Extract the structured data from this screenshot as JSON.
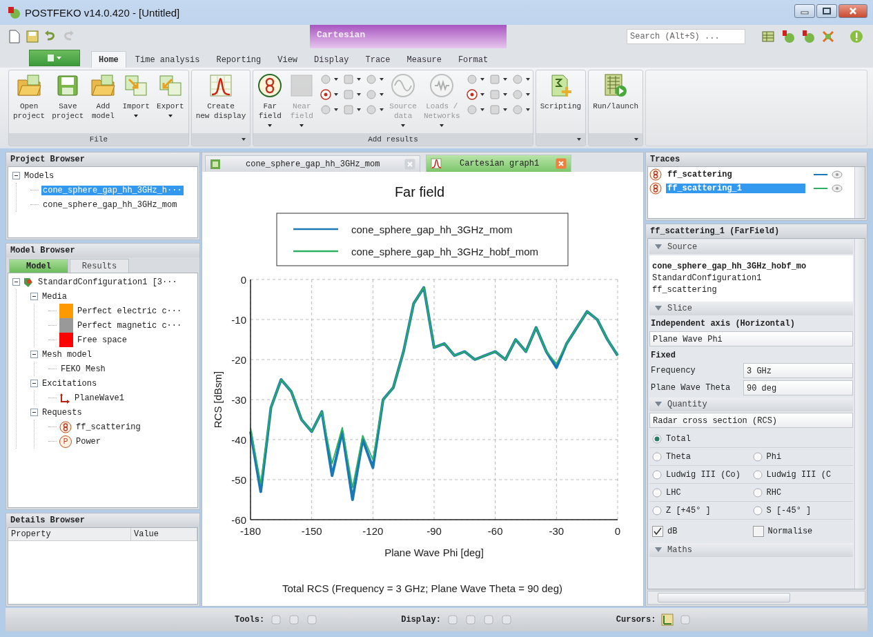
{
  "window": {
    "title": "POSTFEKO v14.0.420 - [Untitled]"
  },
  "contextual_tab_group": {
    "label": "Cartesian"
  },
  "search": {
    "placeholder": "Search (Alt+S) ..."
  },
  "ribbon_tabs": [
    {
      "label": "Home",
      "selected": true,
      "contextual": false
    },
    {
      "label": "Time analysis",
      "selected": false,
      "contextual": false
    },
    {
      "label": "Reporting",
      "selected": false,
      "contextual": false
    },
    {
      "label": "View",
      "selected": false,
      "contextual": false
    },
    {
      "label": "Display",
      "selected": false,
      "contextual": true
    },
    {
      "label": "Trace",
      "selected": false,
      "contextual": true
    },
    {
      "label": "Measure",
      "selected": false,
      "contextual": true
    },
    {
      "label": "Format",
      "selected": false,
      "contextual": true
    }
  ],
  "ribbon_groups": [
    {
      "label": "File",
      "launcher": false,
      "items": [
        {
          "kind": "large",
          "lines": [
            "Open",
            "project"
          ],
          "dropdown": false,
          "disabled": false
        },
        {
          "kind": "large",
          "lines": [
            "Save",
            "project"
          ],
          "dropdown": false,
          "disabled": false
        },
        {
          "kind": "large",
          "lines": [
            "Add",
            "model"
          ],
          "dropdown": false,
          "disabled": false
        },
        {
          "kind": "large",
          "lines": [
            "Import"
          ],
          "dropdown": true,
          "disabled": false
        },
        {
          "kind": "large",
          "lines": [
            "Export"
          ],
          "dropdown": true,
          "disabled": false
        }
      ]
    },
    {
      "launcher": true,
      "items": [
        {
          "kind": "large",
          "lines": [
            "Create",
            "new display"
          ],
          "dropdown": false,
          "disabled": false
        }
      ]
    },
    {
      "label": "Add results",
      "launcher": false,
      "items": [
        {
          "kind": "large",
          "lines": [
            "Far",
            "field"
          ],
          "dropdown": true,
          "disabled": false
        },
        {
          "kind": "large",
          "lines": [
            "Near",
            "field"
          ],
          "dropdown": true,
          "disabled": true
        },
        {
          "kind": "cluster"
        },
        {
          "kind": "large",
          "lines": [
            "Source",
            "data"
          ],
          "dropdown": true,
          "disabled": true
        },
        {
          "kind": "large",
          "lines": [
            "Loads /",
            "Networks"
          ],
          "dropdown": true,
          "disabled": true
        },
        {
          "kind": "cluster"
        }
      ]
    },
    {
      "launcher": true,
      "items": [
        {
          "kind": "large",
          "lines": [
            "Scripting"
          ],
          "dropdown": false,
          "disabled": false
        }
      ]
    },
    {
      "launcher": true,
      "items": [
        {
          "kind": "large",
          "lines": [
            "Run/launch"
          ],
          "dropdown": false,
          "disabled": false
        }
      ]
    }
  ],
  "project_browser": {
    "title": "Project Browser",
    "tree": [
      {
        "label": "Models",
        "expanded": true,
        "selected": false,
        "children": [
          {
            "label": "cone_sphere_gap_hh_3GHz_h···",
            "selected": true
          },
          {
            "label": "cone_sphere_gap_hh_3GHz_mom",
            "selected": false
          }
        ]
      }
    ]
  },
  "model_browser": {
    "title": "Model Browser",
    "tabs": [
      {
        "label": "Model",
        "selected": true
      },
      {
        "label": "Results",
        "selected": false
      }
    ],
    "tree": [
      {
        "label": "StandardConfiguration1 [3···",
        "kind": "config",
        "expanded": true,
        "children": [
          {
            "label": "Media",
            "expanded": true,
            "children": [
              {
                "label": "Perfect electric c···",
                "kind": "material",
                "color": "#ff9900"
              },
              {
                "label": "Perfect magnetic c···",
                "kind": "material",
                "color": "#999999"
              },
              {
                "label": "Free space",
                "kind": "material",
                "color": "#ff0000"
              }
            ]
          },
          {
            "label": "Mesh model",
            "expanded": true,
            "children": [
              {
                "label": "FEKO Mesh"
              }
            ]
          },
          {
            "label": "Excitations",
            "expanded": true,
            "children": [
              {
                "label": "PlaneWave1",
                "kind": "source"
              }
            ]
          },
          {
            "label": "Requests",
            "expanded": true,
            "children": [
              {
                "label": "ff_scattering",
                "kind": "request"
              },
              {
                "label": "Power",
                "kind": "request",
                "badge": "P"
              }
            ]
          }
        ]
      }
    ]
  },
  "details_browser": {
    "title": "Details Browser",
    "columns": [
      "Property",
      "Value"
    ]
  },
  "document_tabs": [
    {
      "label": "cone_sphere_gap_hh_3GHz_mom",
      "kind": "model",
      "selected": false
    },
    {
      "label": "Cartesian graph1",
      "kind": "graph",
      "selected": true
    }
  ],
  "graph": {
    "caption": "Total RCS (Frequency = 3 GHz; Plane Wave Theta = 90 deg)",
    "chart_data": {
      "type": "line",
      "title": "Far field",
      "xlabel": "Plane Wave Phi [deg]",
      "ylabel": "RCS [dBsm]",
      "x": [
        -180,
        -175,
        -170,
        -165,
        -160,
        -155,
        -150,
        -145,
        -140,
        -135,
        -130,
        -125,
        -120,
        -115,
        -110,
        -105,
        -100,
        -95,
        -90,
        -85,
        -80,
        -75,
        -70,
        -65,
        -60,
        -55,
        -50,
        -45,
        -40,
        -35,
        -30,
        -25,
        -20,
        -15,
        -10,
        -5,
        0
      ],
      "series": [
        {
          "name": "cone_sphere_gap_hh_3GHz_mom",
          "color": "#1a78b4",
          "values": [
            -38,
            -53,
            -32,
            -25,
            -28,
            -35,
            -38,
            -33,
            -49,
            -38,
            -55,
            -40,
            -47,
            -30,
            -27,
            -18,
            -6,
            -2,
            -17,
            -16,
            -19,
            -18,
            -20,
            -19,
            -18,
            -20,
            -15,
            -18,
            -12,
            -18,
            -22,
            -16,
            -12,
            -8,
            -10,
            -15,
            -19
          ]
        },
        {
          "name": "cone_sphere_gap_hh_3GHz_hobf_mom",
          "color": "#2cb060",
          "values": [
            -37,
            -51,
            -32,
            -25,
            -28,
            -35,
            -38,
            -33,
            -46,
            -37,
            -52,
            -39,
            -45,
            -30,
            -27,
            -18,
            -6,
            -2,
            -17,
            -16,
            -19,
            -18,
            -20,
            -19,
            -18,
            -20,
            -15,
            -18,
            -12,
            -18,
            -21,
            -16,
            -12,
            -8,
            -10,
            -15,
            -19
          ]
        }
      ],
      "xlim": [
        -180,
        0
      ],
      "ylim": [
        -60,
        0
      ],
      "grid": true,
      "legend": true,
      "xticks": [
        -180,
        -150,
        -120,
        -90,
        -60,
        -30,
        0
      ],
      "yticks": [
        0,
        -10,
        -20,
        -30,
        -40,
        -50,
        -60
      ]
    }
  },
  "traces": {
    "title": "Traces",
    "items": [
      {
        "label": "ff_scattering",
        "selected": false,
        "color": "#1a78b4"
      },
      {
        "label": "ff_scattering_1",
        "selected": true,
        "color": "#2cb060"
      }
    ]
  },
  "properties": {
    "title": "ff_scattering_1 (FarField)",
    "source": {
      "header": "Source",
      "lines": [
        "cone_sphere_gap_hh_3GHz_hobf_mo",
        "StandardConfiguration1",
        "ff_scattering"
      ]
    },
    "slice": {
      "header": "Slice",
      "axis_label": "Independent axis (Horizontal)",
      "axis_value": "Plane Wave Phi",
      "fixed_label": "Fixed",
      "fixed": [
        {
          "label": "Frequency",
          "value": "3 GHz"
        },
        {
          "label": "Plane Wave Theta",
          "value": "90 deg"
        }
      ]
    },
    "quantity": {
      "header": "Quantity",
      "value": "Radar cross section (RCS)",
      "options": [
        [
          {
            "label": "Total",
            "selected": true
          }
        ],
        [
          {
            "label": "Theta",
            "selected": false
          },
          {
            "label": "Phi",
            "selected": false
          }
        ],
        [
          {
            "label": "Ludwig III (Co)",
            "selected": false
          },
          {
            "label": "Ludwig III (C",
            "selected": false
          }
        ],
        [
          {
            "label": "LHC",
            "selected": false
          },
          {
            "label": "RHC",
            "selected": false
          }
        ],
        [
          {
            "label": "Z [+45° ]",
            "selected": false
          },
          {
            "label": "S [-45° ]",
            "selected": false
          }
        ]
      ],
      "checks": [
        {
          "label": "dB",
          "checked": true
        },
        {
          "label": "Normalise",
          "checked": false
        }
      ]
    },
    "maths": {
      "header": "Maths"
    }
  },
  "status_bar": {
    "sections": [
      {
        "label": "Tools:"
      },
      {
        "label": "Display:"
      },
      {
        "label": "Cursors:"
      }
    ]
  }
}
